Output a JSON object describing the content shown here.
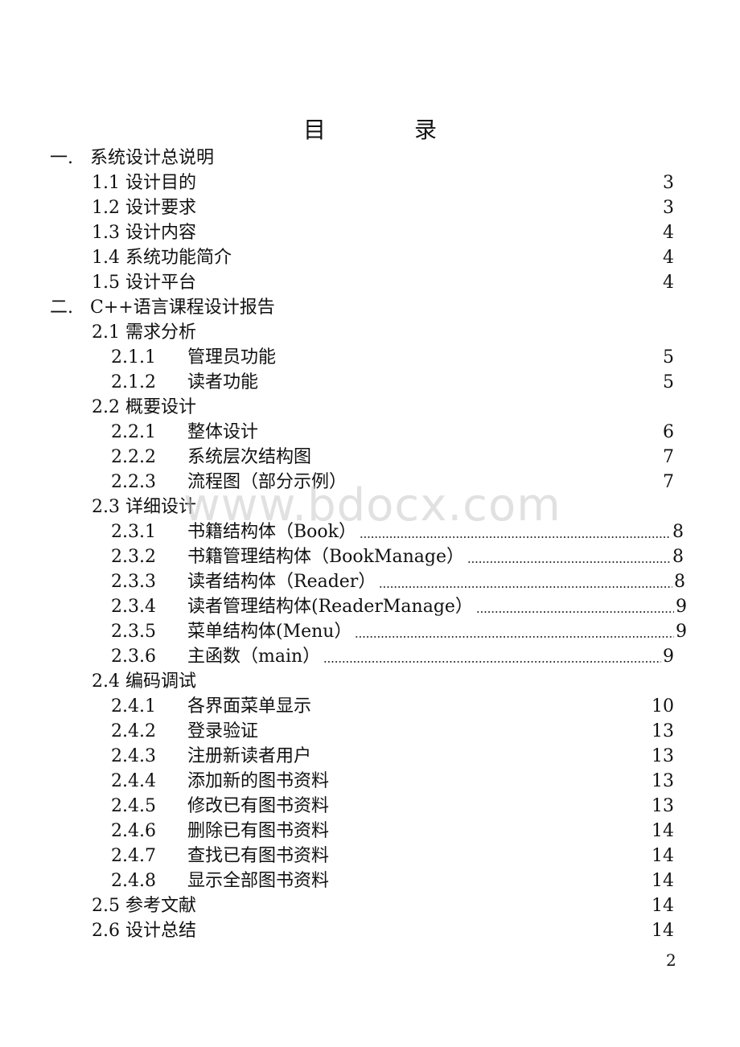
{
  "title": {
    "left": "目",
    "right": "录"
  },
  "watermark": "www.bdocx.com",
  "page_number": "2",
  "toc": {
    "s1": {
      "num": "一.",
      "label": "系统设计总说明"
    },
    "s1_items": [
      {
        "num": "1.1",
        "label": "设计目的",
        "page": "3"
      },
      {
        "num": "1.2",
        "label": "设计要求",
        "page": "3"
      },
      {
        "num": "1.3",
        "label": "设计内容",
        "page": "4"
      },
      {
        "num": "1.4",
        "label": "系统功能简介",
        "page": "4"
      },
      {
        "num": "1.5",
        "label": "设计平台",
        "page": "4"
      }
    ],
    "s2": {
      "num": "二.",
      "label": "C++语言课程设计报告"
    },
    "s2_1": {
      "num": "2.1",
      "label": "需求分析"
    },
    "s2_1_items": [
      {
        "num": "2.1.1",
        "label": "管理员功能",
        "page": "5"
      },
      {
        "num": "2.1.2",
        "label": "读者功能",
        "page": "5"
      }
    ],
    "s2_2": {
      "num": "2.2",
      "label": "概要设计"
    },
    "s2_2_items": [
      {
        "num": "2.2.1",
        "label": "整体设计",
        "page": "6"
      },
      {
        "num": "2.2.2",
        "label": "系统层次结构图",
        "page": "7"
      },
      {
        "num": "2.2.3",
        "label": "流程图（部分示例）",
        "page": "7"
      }
    ],
    "s2_3": {
      "num": "2.3",
      "label": "详细设计"
    },
    "s2_3_items": [
      {
        "num": "2.3.1",
        "label": "书籍结构体（Book）",
        "page": "8"
      },
      {
        "num": "2.3.2",
        "label": "书籍管理结构体（BookManage）",
        "page": "8"
      },
      {
        "num": "2.3.3",
        "label": "读者结构体（Reader）",
        "page": "8"
      },
      {
        "num": "2.3.4",
        "label": "读者管理结构体(ReaderManage）",
        "page": "9"
      },
      {
        "num": "2.3.5",
        "label": "菜单结构体(Menu）",
        "page": "9"
      },
      {
        "num": "2.3.6",
        "label": "主函数（main）",
        "page": "9"
      }
    ],
    "s2_4": {
      "num": "2.4",
      "label": "编码调试"
    },
    "s2_4_items": [
      {
        "num": "2.4.1",
        "label": "各界面菜单显示",
        "page": "10"
      },
      {
        "num": "2.4.2",
        "label": "登录验证",
        "page": "13"
      },
      {
        "num": "2.4.3",
        "label": "注册新读者用户",
        "page": "13"
      },
      {
        "num": "2.4.4",
        "label": "添加新的图书资料",
        "page": "13"
      },
      {
        "num": "2.4.5",
        "label": "修改已有图书资料",
        "page": "13"
      },
      {
        "num": "2.4.6",
        "label": "删除已有图书资料",
        "page": "14"
      },
      {
        "num": "2.4.7",
        "label": "查找已有图书资料",
        "page": "14"
      },
      {
        "num": "2.4.8",
        "label": "显示全部图书资料",
        "page": "14"
      }
    ],
    "s2_5": {
      "num": "2.5",
      "label": "参考文献",
      "page": "14"
    },
    "s2_6": {
      "num": "2.6",
      "label": "设计总结",
      "page": "14"
    }
  }
}
